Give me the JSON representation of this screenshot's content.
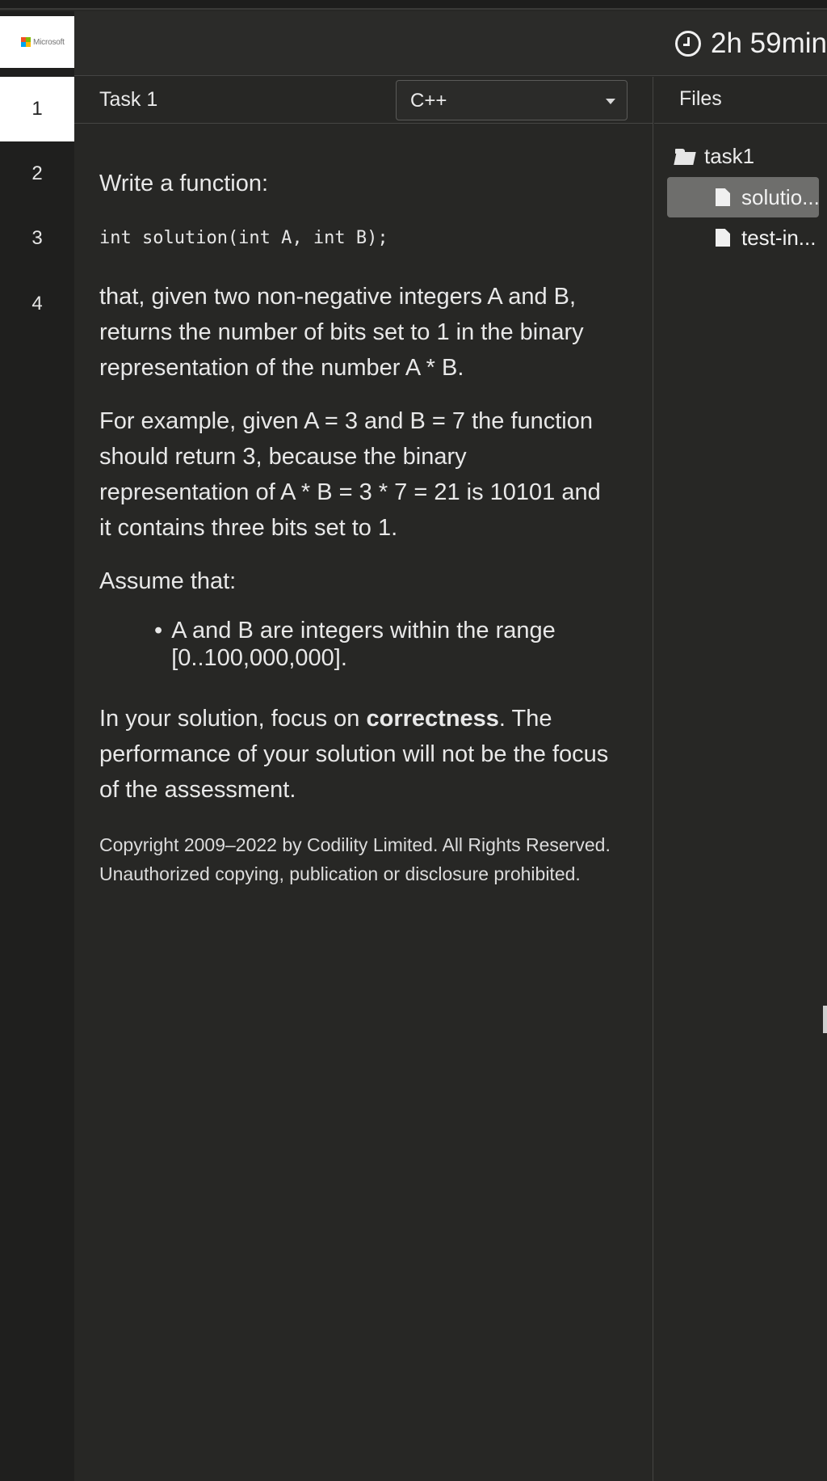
{
  "brand": {
    "logo_text": "Microsoft",
    "colors": [
      "#f25022",
      "#7fba00",
      "#00a4ef",
      "#ffb900"
    ]
  },
  "timer": {
    "icon": "clock-icon",
    "value": "2h 59min"
  },
  "task_tabs": [
    "1",
    "2",
    "3",
    "4"
  ],
  "active_task": "1",
  "task": {
    "title": "Task 1",
    "language": "C++",
    "intro": "Write a function:",
    "signature": "int solution(int A, int B);",
    "para1": "that, given two non-negative integers A and B, returns the number of bits set to 1 in the binary representation of the number A * B.",
    "para2": "For example, given A = 3 and B = 7 the function should return 3, because the binary representation of A * B = 3 * 7 = 21 is 10101 and it contains three bits set to 1.",
    "assume_label": "Assume that:",
    "assumptions": [
      "A and B are integers within the range [0..100,000,000]."
    ],
    "focus_pre": "In your solution, focus on ",
    "focus_bold": "correctness",
    "focus_post": ". The performance of your solution will not be the focus of the assessment.",
    "copyright": "Copyright 2009–2022 by Codility Limited. All Rights Reserved. Unauthorized copying, publication or disclosure prohibited."
  },
  "files": {
    "title": "Files",
    "folder": "task1",
    "items": [
      {
        "label": "solutio...",
        "selected": true
      },
      {
        "label": "test-in...",
        "selected": false
      }
    ]
  }
}
